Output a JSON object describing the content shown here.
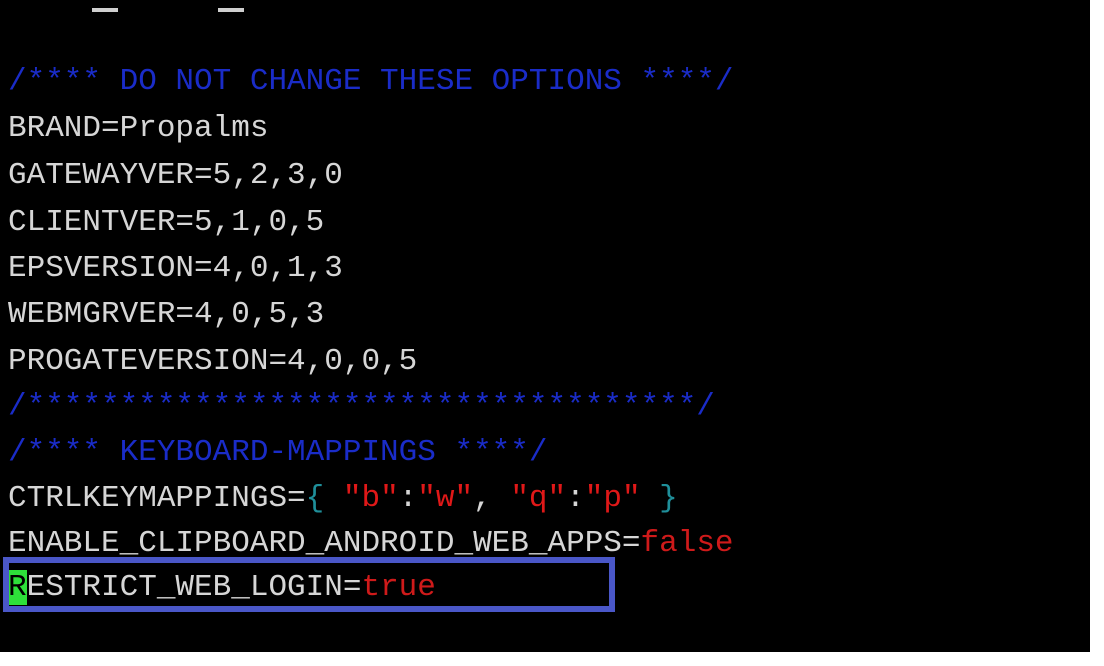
{
  "terminal": {
    "comment_header_1": "/**** DO NOT CHANGE THESE OPTIONS ****/",
    "brand_line": "BRAND=Propalms",
    "gatewayver_line": "GATEWAYVER=5,2,3,0",
    "clientver_line": "CLIENTVER=5,1,0,5",
    "epsversion_line": "EPSVERSION=4,0,1,3",
    "webmgrver_line": "WEBMGRVER=4,0,5,3",
    "progateversion_line": "PROGATEVERSION=4,0,0,5",
    "comment_divider": "/************************************/",
    "comment_header_2": "/**** KEYBOARD-MAPPINGS ****/",
    "ctrlkey": {
      "key": "CTRLKEYMAPPINGS=",
      "open_brace": "{",
      "str_b": "\"b\"",
      "colon_1": ":",
      "str_w": "\"w\"",
      "comma": ", ",
      "str_q": "\"q\"",
      "colon_2": ":",
      "str_p": "\"p\"",
      "close_brace": "}"
    },
    "enable_clipboard": {
      "key": "ENABLE_CLIPBOARD_ANDROID_WEB_APPS=",
      "value": "false"
    },
    "restrict_web_login": {
      "cursor_char": "R",
      "key_rest": "ESTRICT_WEB_LOGIN=",
      "value": "true"
    }
  },
  "colors": {
    "background": "#000000",
    "text": "#d6d6d6",
    "comment": "#1a2cc8",
    "string": "#e01818",
    "boolean": "#cf1a1a",
    "brace": "#1f8f9a",
    "cursor": "#2ee03a",
    "highlight_box": "#4a57c8"
  }
}
